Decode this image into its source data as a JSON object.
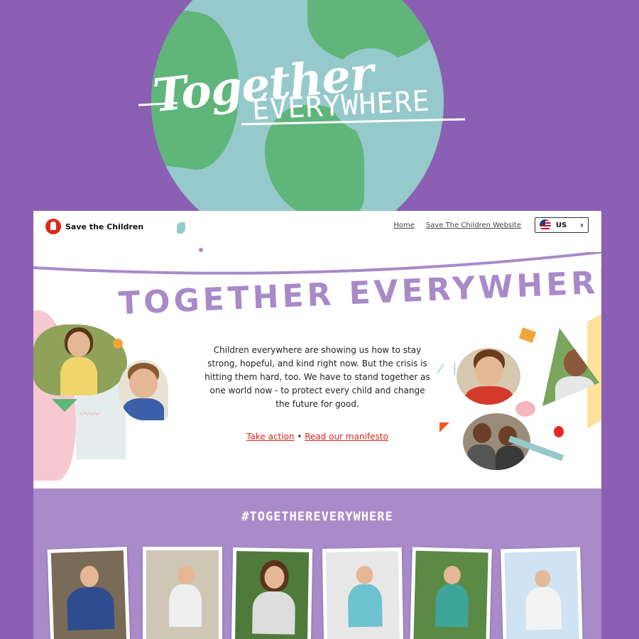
{
  "logo": {
    "script_text": "Together",
    "caps_text": "EVERYWHERE"
  },
  "nav": {
    "brand": "Save the Children",
    "links": [
      "Home",
      "Save The Children Website"
    ],
    "language": "US"
  },
  "banner": {
    "title": "TOGETHER EVERYWHERE"
  },
  "intro": {
    "text": "Children everywhere are showing us how to stay strong, hopeful, and kind right now. But the crisis is hitting them hard, too. We have to stand together as one world now - to protect every child and change the future for good."
  },
  "cta": {
    "take_action": "Take action",
    "separator": "•",
    "manifesto": "Read our manifesto"
  },
  "social": {
    "hashtag": "#TOGETHEREVERYWHERE"
  },
  "colors": {
    "background_purple": "#8b5fb3",
    "globe_ocean": "#96c9cc",
    "globe_land": "#5fb57a",
    "brand_red": "#da291c",
    "banner_lilac": "#a88ac9",
    "section_lilac": "#a98bc9"
  }
}
